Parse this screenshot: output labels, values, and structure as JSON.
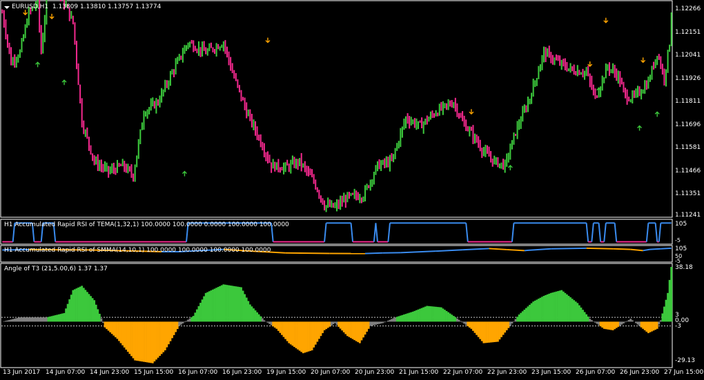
{
  "chart_title": "EURUSD,H1",
  "ohlc": "1.13809 1.13810 1.13757 1.13774",
  "price_ticks": [
    "1.12266",
    "1.12151",
    "1.12041",
    "1.11926",
    "1.11811",
    "1.11696",
    "1.11581",
    "1.11466",
    "1.11351",
    "1.11241"
  ],
  "date_labels": [
    "13 Jun 2017",
    "14 Jun 07:00",
    "14 Jun 23:00",
    "15 Jun 15:00",
    "16 Jun 07:00",
    "16 Jun 23:00",
    "19 Jun 15:00",
    "20 Jun 07:00",
    "20 Jun 23:00",
    "21 Jun 15:00",
    "22 Jun 07:00",
    "22 Jun 23:00",
    "23 Jun 15:00",
    "26 Jun 07:00",
    "26 Jun 23:00",
    "27 Jun 15:00"
  ],
  "indicators": [
    {
      "title": "H1 Accumulated Rapid RSI of TEMA(1,32,1) 100.0000 100.0000 0.0000 100.0000 100.0000",
      "ticks": [
        "105",
        "-5"
      ]
    },
    {
      "title": "H1 Accumulated Rapid RSI of SMMA(14,10,1) 100.0000 100.0000 100.0000 100.0000",
      "ticks": [
        "105",
        "50",
        "-5"
      ]
    },
    {
      "title": "Angle of T3 (21,5.00,6) 1.37 1.37",
      "ticks": [
        "38.18",
        "3",
        "0.00",
        "-3",
        "-29.13"
      ]
    }
  ],
  "colors": {
    "bull": "#3cc83c",
    "bear": "#f0288c",
    "rsi_up": "#3a8cf0",
    "rsi_down": "#f0288c",
    "angle_up": "#3cc83c",
    "angle_down": "#ffa500",
    "separator": "#ffffff",
    "arrow_up": "#3cc83c",
    "arrow_down": "#ffa500"
  },
  "chart_data": {
    "type": "bar",
    "series": [
      {
        "name": "EURUSD,H1",
        "anchors_close": [
          [
            0,
            1.1225
          ],
          [
            5,
            1.12
          ],
          [
            10,
            1.1205
          ],
          [
            15,
            1.1225
          ],
          [
            20,
            1.123
          ],
          [
            22,
            1.1205
          ],
          [
            26,
            1.124
          ],
          [
            30,
            1.1238
          ],
          [
            35,
            1.123
          ],
          [
            40,
            1.122
          ],
          [
            45,
            1.117
          ],
          [
            52,
            1.115
          ],
          [
            60,
            1.1145
          ],
          [
            68,
            1.1148
          ],
          [
            74,
            1.1143
          ],
          [
            80,
            1.1175
          ],
          [
            88,
            1.118
          ],
          [
            96,
            1.1195
          ],
          [
            105,
            1.121
          ],
          [
            115,
            1.1205
          ],
          [
            125,
            1.121
          ],
          [
            130,
            1.1195
          ],
          [
            138,
            1.1175
          ],
          [
            145,
            1.1162
          ],
          [
            152,
            1.1148
          ],
          [
            160,
            1.1147
          ],
          [
            168,
            1.115
          ],
          [
            176,
            1.114
          ],
          [
            182,
            1.1128
          ],
          [
            188,
            1.1127
          ],
          [
            195,
            1.1132
          ],
          [
            204,
            1.1133
          ],
          [
            212,
            1.1148
          ],
          [
            220,
            1.115
          ],
          [
            228,
            1.1172
          ],
          [
            236,
            1.1168
          ],
          [
            245,
            1.1175
          ],
          [
            255,
            1.118
          ],
          [
            260,
            1.117
          ],
          [
            266,
            1.1163
          ],
          [
            272,
            1.1155
          ],
          [
            278,
            1.115
          ],
          [
            284,
            1.1148
          ],
          [
            290,
            1.1165
          ],
          [
            298,
            1.1182
          ],
          [
            306,
            1.1205
          ],
          [
            314,
            1.12
          ],
          [
            322,
            1.1196
          ],
          [
            330,
            1.1195
          ],
          [
            335,
            1.1182
          ],
          [
            342,
            1.1198
          ],
          [
            348,
            1.1193
          ],
          [
            352,
            1.1183
          ],
          [
            356,
            1.1182
          ],
          [
            360,
            1.1185
          ],
          [
            365,
            1.119
          ],
          [
            370,
            1.1205
          ],
          [
            374,
            1.1192
          ],
          [
            377,
            1.121
          ],
          [
            378,
            1.1226
          ]
        ]
      }
    ],
    "rsi_tema": [
      [
        0,
        0
      ],
      [
        6,
        0
      ],
      [
        7,
        100
      ],
      [
        17,
        100
      ],
      [
        18,
        0
      ],
      [
        22,
        0
      ],
      [
        23,
        100
      ],
      [
        29,
        100
      ],
      [
        30,
        0
      ],
      [
        104,
        0
      ],
      [
        105,
        100
      ],
      [
        152,
        100
      ],
      [
        153,
        0
      ],
      [
        182,
        0
      ],
      [
        183,
        100
      ],
      [
        197,
        100
      ],
      [
        198,
        0
      ],
      [
        210,
        0
      ],
      [
        211,
        100
      ],
      [
        212,
        0
      ],
      [
        218,
        0
      ],
      [
        219,
        100
      ],
      [
        262,
        100
      ],
      [
        263,
        0
      ],
      [
        288,
        0
      ],
      [
        289,
        100
      ],
      [
        330,
        100
      ],
      [
        331,
        0
      ],
      [
        333,
        0
      ],
      [
        334,
        100
      ],
      [
        337,
        100
      ],
      [
        338,
        0
      ],
      [
        340,
        0
      ],
      [
        341,
        100
      ],
      [
        346,
        100
      ],
      [
        347,
        0
      ],
      [
        364,
        0
      ],
      [
        365,
        100
      ],
      [
        369,
        100
      ],
      [
        370,
        0
      ],
      [
        371,
        0
      ],
      [
        372,
        100
      ],
      [
        378,
        100
      ]
    ],
    "rsi_smma": [
      [
        0,
        85
      ],
      [
        15,
        88
      ],
      [
        30,
        87
      ],
      [
        50,
        85
      ],
      [
        70,
        78
      ],
      [
        90,
        70
      ],
      [
        100,
        70
      ],
      [
        112,
        80
      ],
      [
        125,
        90
      ],
      [
        140,
        76
      ],
      [
        160,
        60
      ],
      [
        185,
        56
      ],
      [
        205,
        55
      ],
      [
        215,
        60
      ],
      [
        225,
        62
      ],
      [
        245,
        75
      ],
      [
        260,
        86
      ],
      [
        275,
        97
      ],
      [
        285,
        88
      ],
      [
        295,
        80
      ],
      [
        310,
        95
      ],
      [
        330,
        100
      ],
      [
        345,
        95
      ],
      [
        355,
        90
      ],
      [
        362,
        80
      ],
      [
        366,
        90
      ],
      [
        372,
        95
      ],
      [
        378,
        100
      ]
    ],
    "angle_t3": [
      [
        0,
        0
      ],
      [
        10,
        3
      ],
      [
        25,
        3
      ],
      [
        35,
        6
      ],
      [
        40,
        22
      ],
      [
        45,
        25
      ],
      [
        52,
        15
      ],
      [
        58,
        -4
      ],
      [
        65,
        -12
      ],
      [
        75,
        -27
      ],
      [
        85,
        -29
      ],
      [
        92,
        -20
      ],
      [
        100,
        -3
      ],
      [
        108,
        4
      ],
      [
        115,
        20
      ],
      [
        125,
        26
      ],
      [
        135,
        24
      ],
      [
        140,
        12
      ],
      [
        148,
        1
      ],
      [
        155,
        -5
      ],
      [
        162,
        -15
      ],
      [
        170,
        -22
      ],
      [
        175,
        -20
      ],
      [
        182,
        -6
      ],
      [
        188,
        -1
      ],
      [
        195,
        -10
      ],
      [
        202,
        -15
      ],
      [
        208,
        -3
      ],
      [
        215,
        -1
      ],
      [
        222,
        3
      ],
      [
        232,
        7
      ],
      [
        240,
        11
      ],
      [
        248,
        10
      ],
      [
        255,
        4
      ],
      [
        265,
        -5
      ],
      [
        272,
        -15
      ],
      [
        280,
        -14
      ],
      [
        285,
        -6
      ],
      [
        292,
        5
      ],
      [
        300,
        14
      ],
      [
        306,
        18
      ],
      [
        310,
        20
      ],
      [
        316,
        22
      ],
      [
        325,
        13
      ],
      [
        332,
        2
      ],
      [
        340,
        -5
      ],
      [
        345,
        -6
      ],
      [
        350,
        -2
      ],
      [
        355,
        2
      ],
      [
        360,
        -3
      ],
      [
        365,
        -8
      ],
      [
        370,
        -5
      ],
      [
        372,
        1
      ],
      [
        376,
        20
      ],
      [
        378,
        38.18
      ]
    ],
    "arrows": [
      {
        "i": 13,
        "dir": "down",
        "v": 1.1224
      },
      {
        "i": 28,
        "dir": "down",
        "v": 1.1222
      },
      {
        "i": 20,
        "dir": "up",
        "v": 1.12
      },
      {
        "i": 35,
        "dir": "up",
        "v": 1.1191
      },
      {
        "i": 103,
        "dir": "up",
        "v": 1.1145
      },
      {
        "i": 150,
        "dir": "down",
        "v": 1.121
      },
      {
        "i": 265,
        "dir": "down",
        "v": 1.1174
      },
      {
        "i": 287,
        "dir": "up",
        "v": 1.1148
      },
      {
        "i": 332,
        "dir": "down",
        "v": 1.1198
      },
      {
        "i": 341,
        "dir": "down",
        "v": 1.122
      },
      {
        "i": 337,
        "dir": "up",
        "v": 1.1187
      },
      {
        "i": 362,
        "dir": "down",
        "v": 1.12
      },
      {
        "i": 370,
        "dir": "up",
        "v": 1.1175
      },
      {
        "i": 360,
        "dir": "up",
        "v": 1.1168
      }
    ],
    "ylim": [
      1.1123,
      1.123
    ],
    "rsi_ylim": [
      -5,
      105
    ],
    "angle_ylim": [
      -29.13,
      38.18
    ]
  }
}
